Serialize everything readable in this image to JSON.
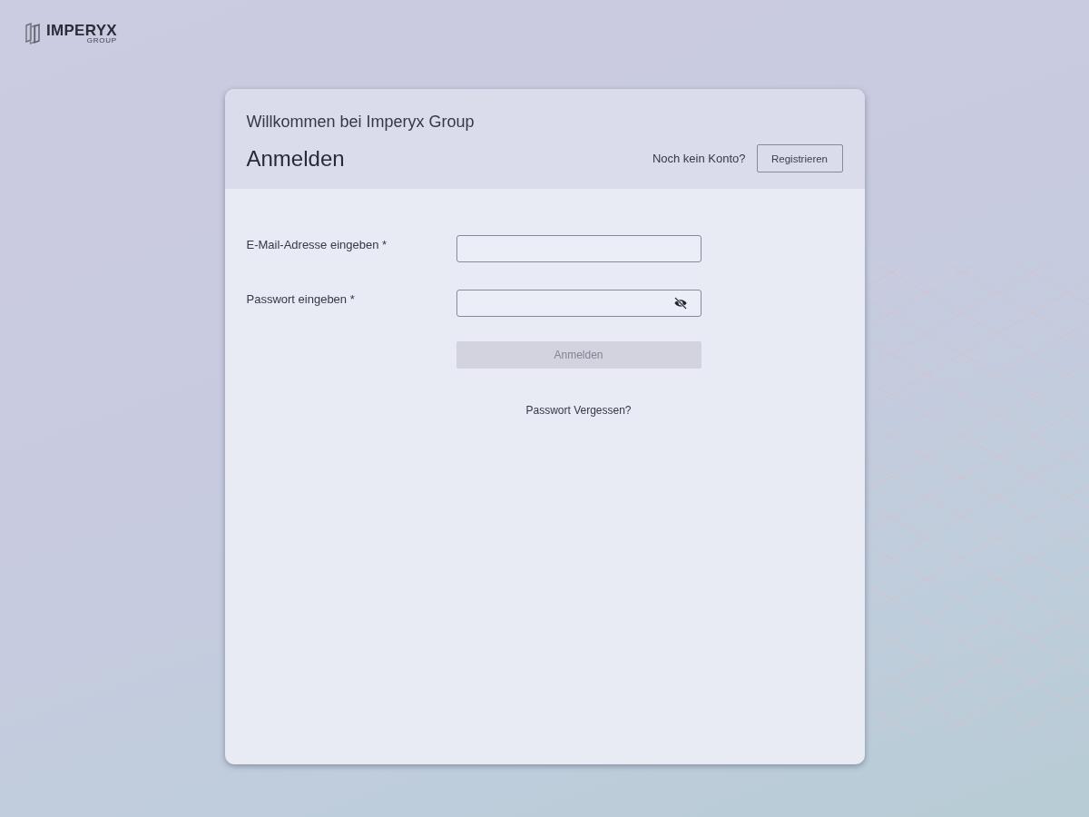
{
  "logo": {
    "name": "IMPERYX",
    "subtitle": "GROUP"
  },
  "card": {
    "welcome": "Willkommen bei Imperyx Group",
    "title": "Anmelden",
    "signup_prompt": "Noch kein Konto?",
    "signup_button": "Registrieren",
    "fields": [
      {
        "label": "E-Mail-Adresse eingeben *",
        "kind": "email"
      },
      {
        "label": "Passwort eingeben *",
        "kind": "password"
      }
    ],
    "submit": {
      "label": "Anmelden",
      "disabled": true
    },
    "forgot_link": "Passwort Vergessen?"
  }
}
